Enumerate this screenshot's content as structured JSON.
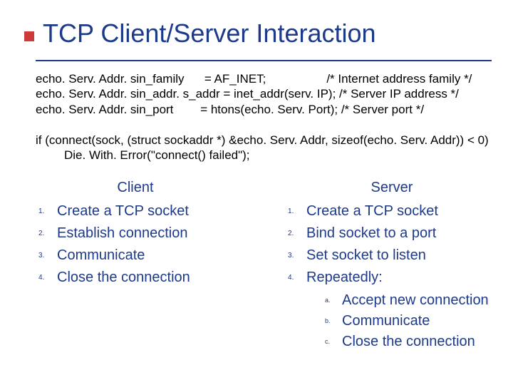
{
  "title": "TCP Client/Server Interaction",
  "code": {
    "l1": "echo. Serv. Addr. sin_family      = AF_INET;                  /* Internet address family */",
    "l2": "echo. Serv. Addr. sin_addr. s_addr = inet_addr(serv. IP); /* Server IP address */",
    "l3": "echo. Serv. Addr. sin_port        = htons(echo. Serv. Port); /* Server port */",
    "if1": "if (connect(sock, (struct sockaddr *) &echo. Serv. Addr, sizeof(echo. Serv. Addr)) < 0)",
    "if2": "Die. With. Error(\"connect() failed\");"
  },
  "client": {
    "header": "Client",
    "items": [
      "Create a TCP socket",
      "Establish connection",
      "Communicate",
      "Close the connection"
    ]
  },
  "server": {
    "header": "Server",
    "items": [
      "Create a TCP socket",
      "Bind socket to a port",
      "Set socket to listen",
      "Repeatedly:"
    ],
    "subitems": [
      "Accept new connection",
      "Communicate",
      "Close the connection"
    ]
  }
}
